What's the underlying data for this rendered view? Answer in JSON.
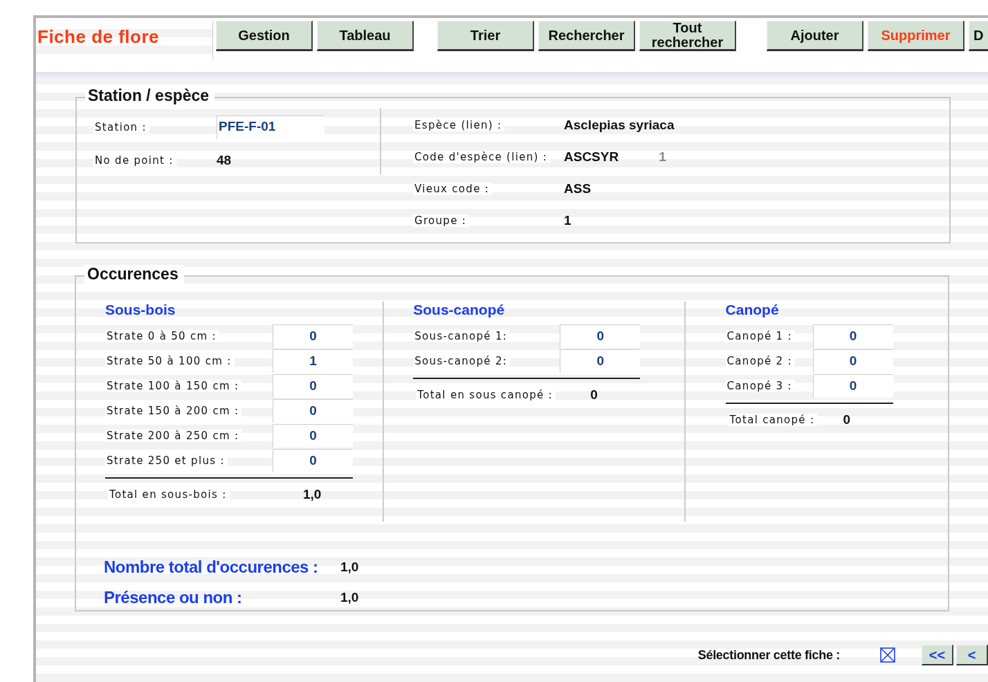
{
  "app": {
    "title": "Fiche de flore"
  },
  "toolbar": [
    {
      "label": "Gestion",
      "kind": "normal"
    },
    {
      "label": "Tableau",
      "kind": "normal"
    },
    {
      "label": "Trier",
      "kind": "normal"
    },
    {
      "label": "Rechercher",
      "kind": "normal"
    },
    {
      "label": "Tout rechercher",
      "kind": "normal"
    },
    {
      "label": "Ajouter",
      "kind": "normal"
    },
    {
      "label": "Supprimer",
      "kind": "danger"
    },
    {
      "label": "D",
      "kind": "normal"
    }
  ],
  "station_section": {
    "legend": "Station / espèce",
    "station_label": "Station :",
    "station_value": "PFE-F-01",
    "point_label": "No de point :",
    "point_value": "48",
    "species_label": "Espèce (lien) :",
    "species_value": "Asclepias syriaca",
    "code_label": "Code d'espèce (lien) :",
    "code_value": "ASCSYR",
    "code_extra": "1",
    "old_code_label": "Vieux code :",
    "old_code_value": "ASS",
    "group_label": "Groupe :",
    "group_value": "1"
  },
  "occurrences": {
    "legend": "Occurences",
    "columns": [
      {
        "title": "Sous-bois",
        "rows": [
          {
            "label": "Strate 0 à 50 cm :",
            "value": "0"
          },
          {
            "label": "Strate 50 à 100 cm :",
            "value": "1"
          },
          {
            "label": "Strate 100 à 150 cm :",
            "value": "0"
          },
          {
            "label": "Strate 150 à 200 cm :",
            "value": "0"
          },
          {
            "label": "Strate 200 à 250 cm :",
            "value": "0"
          },
          {
            "label": "Strate 250 et plus :",
            "value": "0"
          }
        ],
        "total_label": "Total en sous-bois :",
        "total_value": "1,0"
      },
      {
        "title": "Sous-canopé",
        "rows": [
          {
            "label": "Sous-canopé 1:",
            "value": "0"
          },
          {
            "label": "Sous-canopé 2:",
            "value": "0"
          }
        ],
        "total_label": "Total en sous canopé :",
        "total_value": "0"
      },
      {
        "title": "Canopé",
        "rows": [
          {
            "label": "Canopé 1 :",
            "value": "0"
          },
          {
            "label": "Canopé 2 :",
            "value": "0"
          },
          {
            "label": "Canopé 3 :",
            "value": "0"
          }
        ],
        "total_label": "Total canopé :",
        "total_value": "0"
      }
    ],
    "summary": [
      {
        "label": "Nombre total d'occurences :",
        "value": "1,0"
      },
      {
        "label": "Présence ou non :",
        "value": "1,0"
      }
    ]
  },
  "footer": {
    "select_label": "Sélectionner cette fiche :",
    "checked": true,
    "nav": [
      "<<",
      "<"
    ]
  }
}
